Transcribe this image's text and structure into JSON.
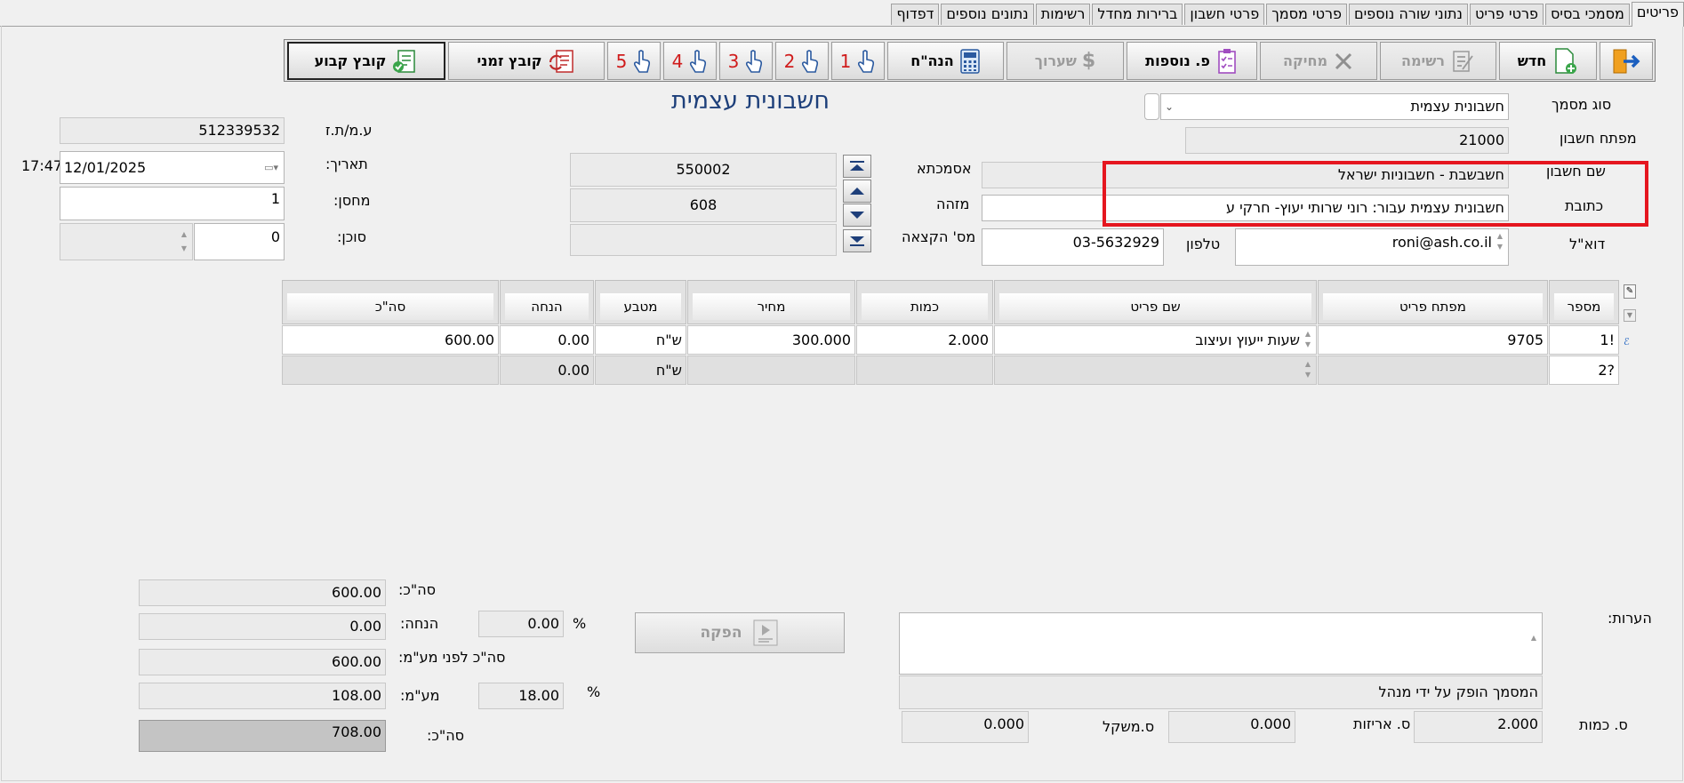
{
  "tabs": [
    "פריטים",
    "מסמכי בסיס",
    "פרטי פריט",
    "נתוני שורה נוספים",
    "פרטי מסמך",
    "פרטי חשבון",
    "ברירות מחדל",
    "רשימות",
    "נתונים נוספים",
    "דפדוף"
  ],
  "toolbar": {
    "exit": "",
    "new": "חדש",
    "list": "רשימה",
    "delete": "מחיקה",
    "more": "פ. נוספות",
    "values": "שערוך",
    "calc": "הנה\"ח",
    "n1": "1",
    "n2": "2",
    "n3": "3",
    "n4": "4",
    "n5": "5",
    "temp_file": "קובץ זמני",
    "perm_file": "קובץ קבוע"
  },
  "doc_title": "חשבונית עצמית",
  "form": {
    "doc_type_label": "סוג מסמך",
    "doc_type_value": "חשבונית עצמית",
    "account_key_label": "מפתח חשבון",
    "account_key_value": "21000",
    "account_name_label": "שם חשבון",
    "account_name_value": "חשבשבת - חשבוניות ישראל",
    "address_label": "כתובת",
    "address_value": "חשבונית עצמית עבור: רוני שרותי יעוץ- חרקי ע",
    "email_label": "דוא\"ל",
    "email_value": "roni@ash.co.il",
    "phone_label": "טלפון",
    "phone_value": "03-5632929",
    "asmachta_label": "אסמכתא",
    "asmachta_value": "550002",
    "id_label": "מזהה",
    "id_value": "608",
    "alloc_label": "מס' הקצאה",
    "alloc_value": "",
    "vat_id_label": "ע.מ/ת.ז",
    "vat_id_value": "512339532",
    "date_label": "תאריך:",
    "date_value": "12/01/2025",
    "time_value": "17:47",
    "warehouse_label": "מחסן:",
    "warehouse_value": "1",
    "agent_label": "סוכן:",
    "agent_value": "0"
  },
  "grid": {
    "headers": {
      "num": "מספר",
      "key": "מפתח פריט",
      "name": "שם פריט",
      "qty": "כמות",
      "price": "מחיר",
      "currency": "מטבע",
      "discount": "הנחה",
      "total": "סה\"כ"
    },
    "rows": [
      {
        "num": "1!",
        "key": "9705",
        "name": "שעות ייעוץ ועיצוב",
        "qty": "2.000",
        "price": "300.000",
        "currency": "ש\"ח",
        "discount": "0.00",
        "total": "600.00"
      },
      {
        "num": "2?",
        "key": "",
        "name": "",
        "qty": "",
        "price": "",
        "currency": "ש\"ח",
        "discount": "0.00",
        "total": ""
      }
    ]
  },
  "totals": {
    "subtotal_label": "סה\"כ:",
    "subtotal_value": "600.00",
    "discount_label": "הנחה:",
    "discount_value": "0.00",
    "discount_pct": "0.00",
    "pre_vat_label": "סה\"כ לפני מע\"מ:",
    "pre_vat_value": "600.00",
    "vat_label": "מע\"מ:",
    "vat_value": "108.00",
    "vat_pct": "18.00",
    "total_label": "סה\"כ:",
    "total_value": "708.00",
    "pct_sign": "%"
  },
  "produce_button": "הפקה",
  "notes": {
    "label": "הערות:",
    "value": "",
    "issued_text": "המסמך הופק  על ידי מנהל"
  },
  "summary": {
    "qty_label": "ס. כמות",
    "qty_value": "2.000",
    "packages_label": "ס. אריזות",
    "packages_value": "0.000",
    "weight_label": "ס.משקל",
    "weight_value": "0.000"
  }
}
